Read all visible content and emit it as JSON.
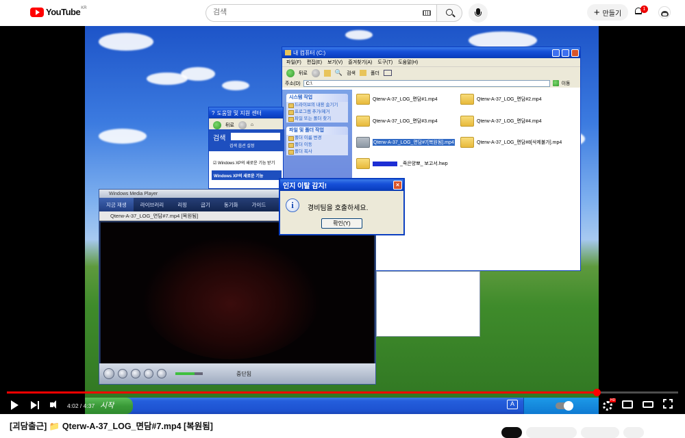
{
  "header": {
    "logo_text": "YouTube",
    "region": "KR",
    "search_placeholder": "검색",
    "create_label": "만들기",
    "notification_count": "1"
  },
  "video": {
    "explorer": {
      "title": "내 컴퓨터 (C:)",
      "menu": [
        "파일(F)",
        "편집(E)",
        "보기(V)",
        "즐겨찾기(A)",
        "도구(T)",
        "도움말(H)"
      ],
      "toolbar": {
        "back": "뒤로",
        "search": "검색",
        "folders": "폴더"
      },
      "address_label": "주소(D)",
      "address_value": "C:\\",
      "go_label": "이동",
      "system_tasks_title": "시스템 작업",
      "system_tasks": [
        "드라이브의 내용 숨기기",
        "프로그램 추가/제거",
        "파일 또는 폴더 찾기"
      ],
      "file_tasks_title": "파일 및 폴더 작업",
      "file_tasks": [
        "폴더 이름 변경",
        "폴더 이동",
        "폴더 복사"
      ],
      "files": [
        "Qterw-A-37_LOG_면담#1.mp4",
        "Qterw-A-37_LOG_면담#2.mp4",
        "Qterw-A-37_LOG_면담#3.mp4",
        "Qterw-A-37_LOG_면담#4.mp4",
        "Qterw-A-37_LOG_면담#7[복원됨].mp4",
        "Qterw-A-37_LOG_면담#8[삭제불가].mp4",
        "_죽은양뽀_ 보고서.hwp"
      ]
    },
    "help_center": {
      "title": "도움말 및 지원 센터",
      "back": "뒤로",
      "search_label": "검색",
      "search_sub": "검색 옵션 설정",
      "checkbox_text": "Windows XP의 새로운 기능 받기",
      "news_heading": "Windows XP의 새로운 기능"
    },
    "wmp": {
      "title": "Windows Media Player",
      "tabs": [
        "지금 재생",
        "라이브러리",
        "리핑",
        "굽기",
        "동기화",
        "가이드"
      ],
      "now_playing": "Qterw-A-37_LOG_면담#7.mp4 [복원됨]",
      "status": "중단됨"
    },
    "alert": {
      "title": "인지 이탈 감지!",
      "message": "경비팀을 호출하세요.",
      "ok_label": "확인(Y)"
    },
    "taskbar": {
      "start_label": "시작"
    }
  },
  "player": {
    "current_time": "4:02",
    "duration": "4:37",
    "progress_fraction": 0.879
  },
  "page": {
    "video_title": "[괴담출근] 📁 Qterw-A-37_LOG_면담#7.mp4 [복원됨]"
  }
}
